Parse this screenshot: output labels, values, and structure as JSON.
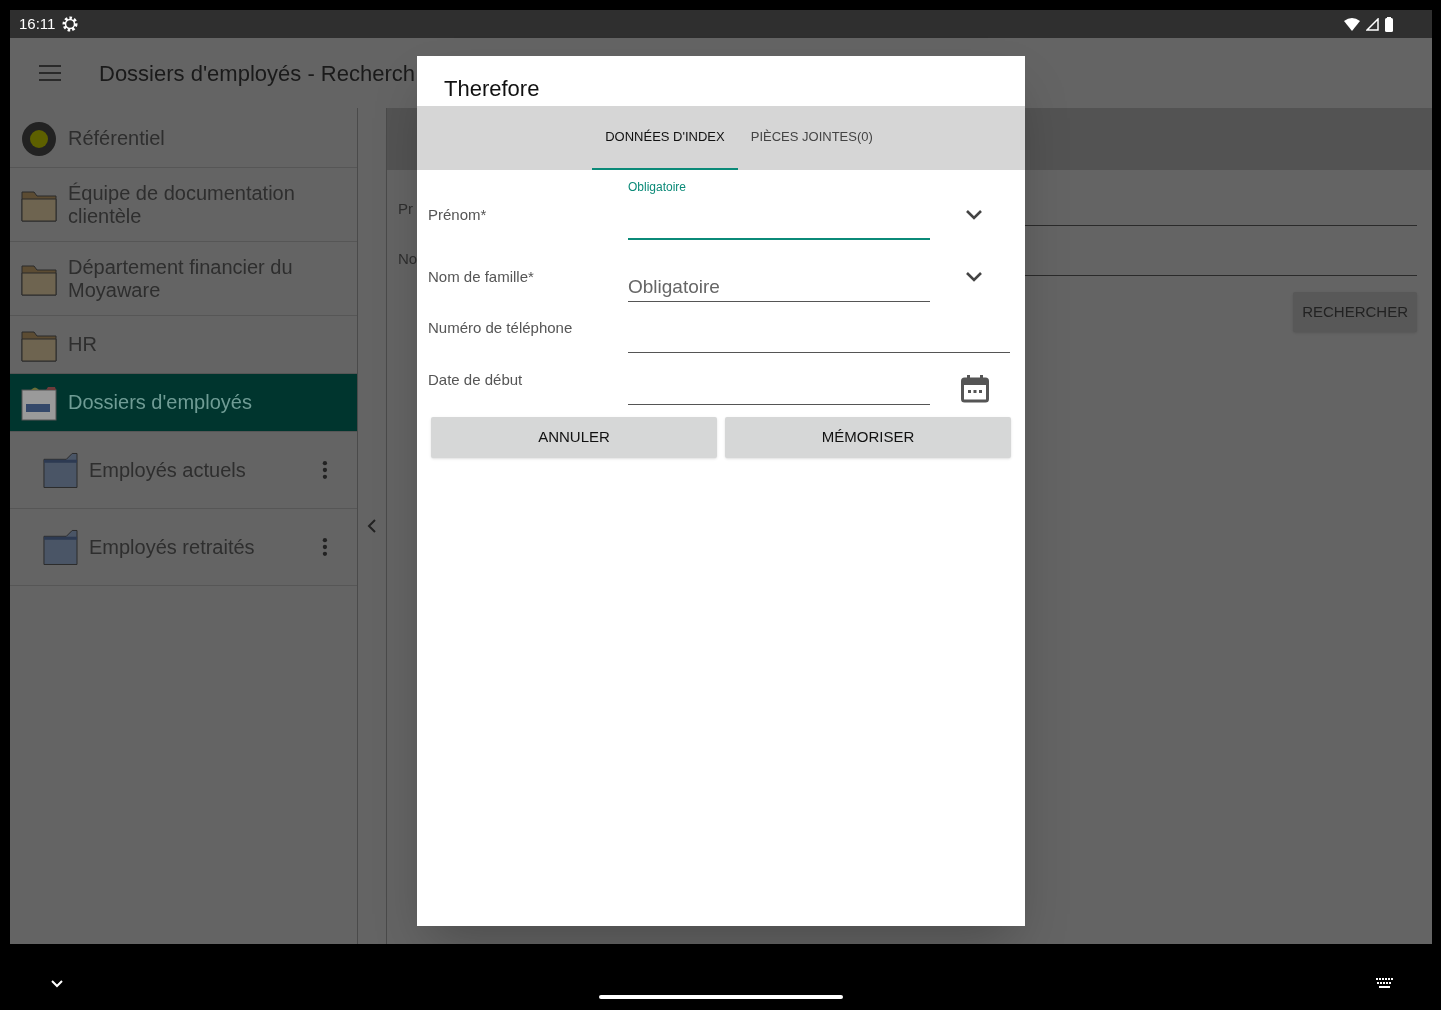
{
  "status_bar": {
    "time": "16:11"
  },
  "app_bar": {
    "title": "Dossiers d'employés - Recherch"
  },
  "sidebar": {
    "items": [
      {
        "label": "Référentiel",
        "kind": "repository",
        "selected": false
      },
      {
        "label": "Équipe de documentation clientèle",
        "kind": "folder",
        "selected": false
      },
      {
        "label": "Département financier du Moyaware",
        "kind": "folder",
        "selected": false
      },
      {
        "label": "HR",
        "kind": "folder",
        "selected": false
      },
      {
        "label": "Dossiers d'employés",
        "kind": "cabinet",
        "selected": true,
        "children": [
          {
            "label": "Employés actuels",
            "kind": "subfolder",
            "selected": false
          },
          {
            "label": "Employés retraités",
            "kind": "subfolder",
            "selected": false
          }
        ]
      }
    ]
  },
  "search_form": {
    "fields": [
      "Pr",
      "No"
    ],
    "button": "RECHERCHER"
  },
  "dialog": {
    "title": "Therefore",
    "tabs": [
      {
        "label": "DONNÉES D'INDEX",
        "selected": true
      },
      {
        "label": "PIÈCES JOINTES(0)",
        "selected": false
      }
    ],
    "fields": [
      {
        "label": "Prénom*",
        "kind": "dropdown",
        "placeholder": "Obligatoire",
        "focused": true
      },
      {
        "label": "Nom de famille*",
        "kind": "dropdown",
        "placeholder": "Obligatoire",
        "focused": false
      },
      {
        "label": "Numéro de téléphone",
        "kind": "text",
        "focused": false
      },
      {
        "label": "Date de début",
        "kind": "date",
        "focused": false
      }
    ],
    "buttons": [
      "ANNULER",
      "MÉMORISER"
    ]
  }
}
